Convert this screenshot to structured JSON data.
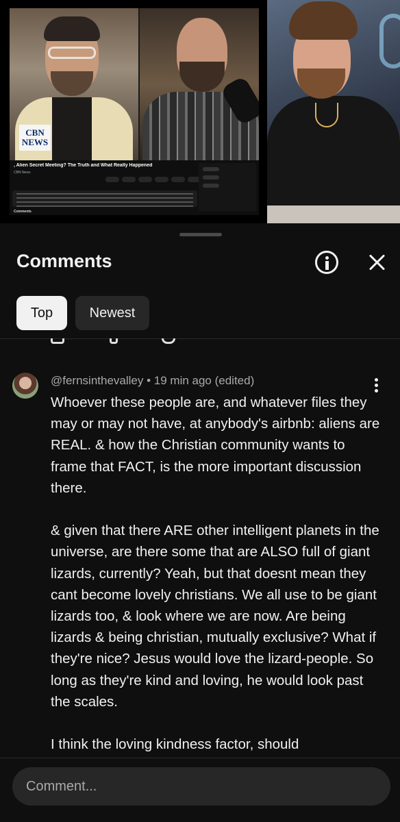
{
  "video": {
    "channel_logo": "CBN NEWS",
    "video_title": ", Alien Secret Meeting? The Truth and What Really Happened",
    "channel_name": "CBN News",
    "comments_label": "Comments"
  },
  "sheet": {
    "title": "Comments",
    "info_icon": "info-icon",
    "close_icon": "close-icon"
  },
  "filters": {
    "top_label": "Top",
    "newest_label": "Newest"
  },
  "comment": {
    "meta": "@fernsinthevalley • 19 min ago (edited)",
    "paragraphs": [
      "Whoever these people are, and whatever files they may or may not have, at anybody's airbnb: aliens are REAL. & how the Christian community wants to frame that FACT, is the more important discussion there.",
      "& given that there ARE other intelligent planets in the universe, are there some that are ALSO full of giant lizards, currently? Yeah, but that doesnt mean they cant become lovely christians. We all use to be giant lizards too, & look where we are now. Are being lizards & being christian, mutually exclusive? What if they're nice? Jesus would love the lizard-people. So long as they're kind and loving, he would look past the scales.",
      "I think the loving kindness factor, should"
    ]
  },
  "input": {
    "placeholder": "Comment..."
  }
}
